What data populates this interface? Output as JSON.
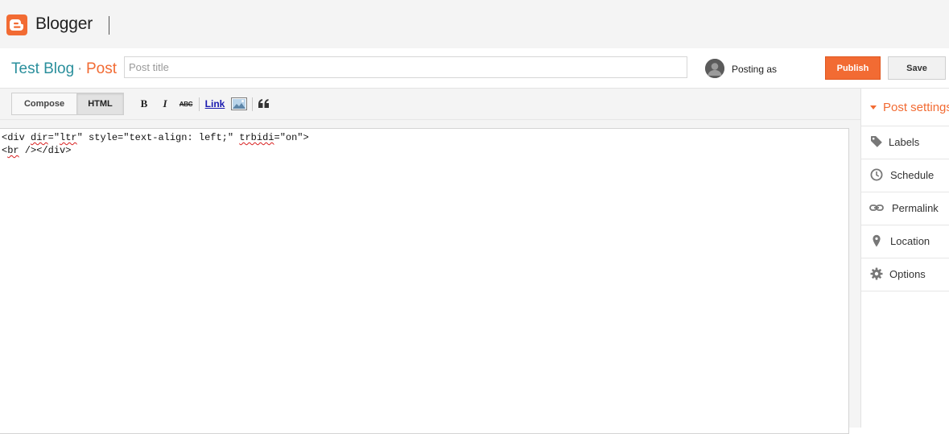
{
  "app": {
    "name": "Blogger",
    "brand_color": "#f26b33",
    "icons": {
      "logo": "blogger-logo-icon"
    }
  },
  "header": {
    "blog_name": "Test Blog",
    "separator": "·",
    "crumb": "Post",
    "title_placeholder": "Post title",
    "title_value": "",
    "posting_as": "Posting as",
    "publish_label": "Publish",
    "save_label": "Save"
  },
  "toolbar": {
    "compose_label": "Compose",
    "html_label": "HTML",
    "active_mode": "HTML",
    "bold_label": "B",
    "italic_label": "I",
    "strike_label": "ABC",
    "link_label": "Link",
    "icons": [
      "bold-icon",
      "italic-icon",
      "strikethrough-icon",
      "link-icon",
      "image-icon",
      "quote-icon"
    ]
  },
  "editor": {
    "line1": {
      "p1": "<div ",
      "p2": "dir",
      "p3": "=\"",
      "p4": "ltr",
      "p5": "\" style=\"text-align: left;\" ",
      "p6": "trbidi",
      "p7": "=\"on\">"
    },
    "line2": {
      "p1": "<",
      "p2": "br",
      "p3": " /></div>"
    }
  },
  "sidebar": {
    "heading": "Post settings",
    "items": [
      {
        "label": "Labels",
        "icon": "tag-icon"
      },
      {
        "label": "Schedule",
        "icon": "clock-icon"
      },
      {
        "label": "Permalink",
        "icon": "link-icon"
      },
      {
        "label": "Location",
        "icon": "map-pin-icon"
      },
      {
        "label": "Options",
        "icon": "gear-icon"
      }
    ]
  }
}
